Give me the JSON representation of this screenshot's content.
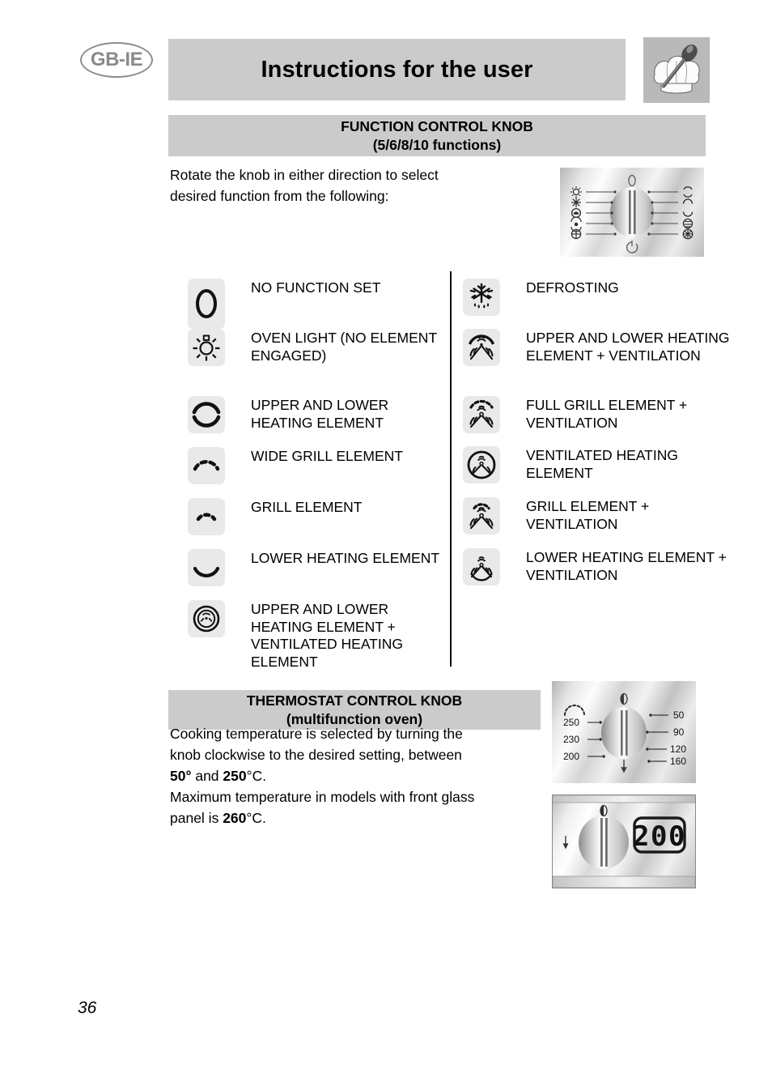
{
  "header": {
    "country_badge": "GB-IE",
    "title": "Instructions for the user",
    "logo_icon": "chef-hat-spoon-icon"
  },
  "function_section": {
    "heading_line1": "FUNCTION CONTROL KNOB",
    "heading_line2": "(5/6/8/10 functions)",
    "intro_line1": "Rotate the knob in either direction to select",
    "intro_line2": "desired function from the following:",
    "knob_illustration": {
      "name": "function-control-knob-diagram",
      "pointer_top": "off-marker",
      "pointer_bottom": "power-symbol"
    },
    "left_column": [
      {
        "icon": "no-function-set-icon",
        "label": "NO FUNCTION SET"
      },
      {
        "icon": "oven-light-icon",
        "label": "OVEN LIGHT (NO ELEMENT ENGAGED)"
      },
      {
        "icon": "upper-lower-heating-icon",
        "label": "UPPER AND LOWER HEATING ELEMENT"
      },
      {
        "icon": "wide-grill-icon",
        "label": "WIDE GRILL ELEMENT"
      },
      {
        "icon": "grill-icon",
        "label": "GRILL ELEMENT"
      },
      {
        "icon": "lower-heating-icon",
        "label": "LOWER HEATING ELEMENT"
      },
      {
        "icon": "upper-lower-ventilated-heating-icon",
        "label": "UPPER AND LOWER HEATING ELEMENT + VENTILATED HEATING ELEMENT"
      }
    ],
    "right_column": [
      {
        "icon": "defrosting-icon",
        "label": "DEFROSTING"
      },
      {
        "icon": "upper-lower-heating-ventilation-icon",
        "label": "UPPER AND LOWER HEATING ELEMENT + VENTILATION"
      },
      {
        "icon": "full-grill-ventilation-icon",
        "label": "FULL GRILL ELEMENT + VENTILATION"
      },
      {
        "icon": "ventilated-heating-icon",
        "label": "VENTILATED HEATING ELEMENT"
      },
      {
        "icon": "grill-ventilation-icon",
        "label": "GRILL ELEMENT + VENTILATION"
      },
      {
        "icon": "lower-heating-ventilation-icon",
        "label": "LOWER HEATING ELEMENT + VENTILATION"
      }
    ]
  },
  "thermostat_section": {
    "heading_line1": "THERMOSTAT CONTROL KNOB",
    "heading_line2": "(multifunction oven)",
    "body_line1": "Cooking temperature is selected by turning the",
    "body_line2": "knob clockwise to the desired setting, between",
    "body_line3_prefix": "",
    "value_min": "50°",
    "body_line3_mid": " and ",
    "value_max": "250",
    "body_line3_suffix": "°C.",
    "body_line4": "Maximum temperature in models with front glass",
    "body_line5_prefix": "panel is ",
    "value_glass_max": "260",
    "body_line5_suffix": "°C.",
    "knob_illustration": {
      "name": "thermostat-knob-diagram",
      "left_marks": [
        "250",
        "230",
        "200"
      ],
      "right_marks": [
        "50",
        "90",
        "120",
        "160"
      ]
    },
    "display_illustration": {
      "name": "digital-display-panel",
      "display_value": "200"
    }
  },
  "footer": {
    "page_number": "36"
  },
  "colors": {
    "bar_gray": "#cbcbcb",
    "icon_tile": "#e9e9e9",
    "badge_gray": "#8a8a8a"
  }
}
